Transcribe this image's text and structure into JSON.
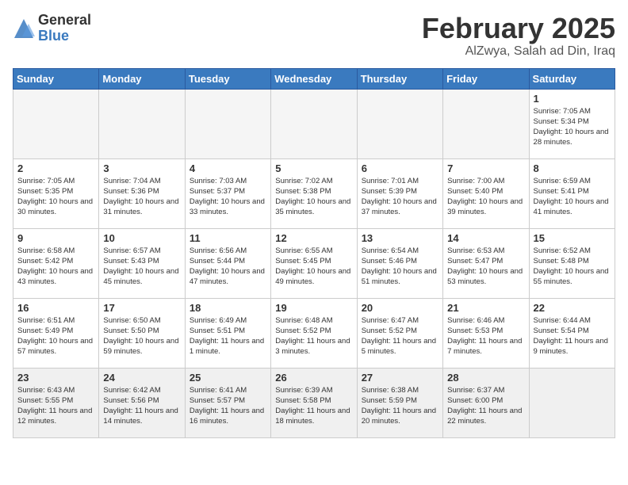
{
  "header": {
    "logo_general": "General",
    "logo_blue": "Blue",
    "title": "February 2025",
    "subtitle": "AlZwya, Salah ad Din, Iraq"
  },
  "weekdays": [
    "Sunday",
    "Monday",
    "Tuesday",
    "Wednesday",
    "Thursday",
    "Friday",
    "Saturday"
  ],
  "weeks": [
    [
      {
        "day": "",
        "info": ""
      },
      {
        "day": "",
        "info": ""
      },
      {
        "day": "",
        "info": ""
      },
      {
        "day": "",
        "info": ""
      },
      {
        "day": "",
        "info": ""
      },
      {
        "day": "",
        "info": ""
      },
      {
        "day": "1",
        "info": "Sunrise: 7:05 AM\nSunset: 5:34 PM\nDaylight: 10 hours and 28 minutes."
      }
    ],
    [
      {
        "day": "2",
        "info": "Sunrise: 7:05 AM\nSunset: 5:35 PM\nDaylight: 10 hours and 30 minutes."
      },
      {
        "day": "3",
        "info": "Sunrise: 7:04 AM\nSunset: 5:36 PM\nDaylight: 10 hours and 31 minutes."
      },
      {
        "day": "4",
        "info": "Sunrise: 7:03 AM\nSunset: 5:37 PM\nDaylight: 10 hours and 33 minutes."
      },
      {
        "day": "5",
        "info": "Sunrise: 7:02 AM\nSunset: 5:38 PM\nDaylight: 10 hours and 35 minutes."
      },
      {
        "day": "6",
        "info": "Sunrise: 7:01 AM\nSunset: 5:39 PM\nDaylight: 10 hours and 37 minutes."
      },
      {
        "day": "7",
        "info": "Sunrise: 7:00 AM\nSunset: 5:40 PM\nDaylight: 10 hours and 39 minutes."
      },
      {
        "day": "8",
        "info": "Sunrise: 6:59 AM\nSunset: 5:41 PM\nDaylight: 10 hours and 41 minutes."
      }
    ],
    [
      {
        "day": "9",
        "info": "Sunrise: 6:58 AM\nSunset: 5:42 PM\nDaylight: 10 hours and 43 minutes."
      },
      {
        "day": "10",
        "info": "Sunrise: 6:57 AM\nSunset: 5:43 PM\nDaylight: 10 hours and 45 minutes."
      },
      {
        "day": "11",
        "info": "Sunrise: 6:56 AM\nSunset: 5:44 PM\nDaylight: 10 hours and 47 minutes."
      },
      {
        "day": "12",
        "info": "Sunrise: 6:55 AM\nSunset: 5:45 PM\nDaylight: 10 hours and 49 minutes."
      },
      {
        "day": "13",
        "info": "Sunrise: 6:54 AM\nSunset: 5:46 PM\nDaylight: 10 hours and 51 minutes."
      },
      {
        "day": "14",
        "info": "Sunrise: 6:53 AM\nSunset: 5:47 PM\nDaylight: 10 hours and 53 minutes."
      },
      {
        "day": "15",
        "info": "Sunrise: 6:52 AM\nSunset: 5:48 PM\nDaylight: 10 hours and 55 minutes."
      }
    ],
    [
      {
        "day": "16",
        "info": "Sunrise: 6:51 AM\nSunset: 5:49 PM\nDaylight: 10 hours and 57 minutes."
      },
      {
        "day": "17",
        "info": "Sunrise: 6:50 AM\nSunset: 5:50 PM\nDaylight: 10 hours and 59 minutes."
      },
      {
        "day": "18",
        "info": "Sunrise: 6:49 AM\nSunset: 5:51 PM\nDaylight: 11 hours and 1 minute."
      },
      {
        "day": "19",
        "info": "Sunrise: 6:48 AM\nSunset: 5:52 PM\nDaylight: 11 hours and 3 minutes."
      },
      {
        "day": "20",
        "info": "Sunrise: 6:47 AM\nSunset: 5:52 PM\nDaylight: 11 hours and 5 minutes."
      },
      {
        "day": "21",
        "info": "Sunrise: 6:46 AM\nSunset: 5:53 PM\nDaylight: 11 hours and 7 minutes."
      },
      {
        "day": "22",
        "info": "Sunrise: 6:44 AM\nSunset: 5:54 PM\nDaylight: 11 hours and 9 minutes."
      }
    ],
    [
      {
        "day": "23",
        "info": "Sunrise: 6:43 AM\nSunset: 5:55 PM\nDaylight: 11 hours and 12 minutes."
      },
      {
        "day": "24",
        "info": "Sunrise: 6:42 AM\nSunset: 5:56 PM\nDaylight: 11 hours and 14 minutes."
      },
      {
        "day": "25",
        "info": "Sunrise: 6:41 AM\nSunset: 5:57 PM\nDaylight: 11 hours and 16 minutes."
      },
      {
        "day": "26",
        "info": "Sunrise: 6:39 AM\nSunset: 5:58 PM\nDaylight: 11 hours and 18 minutes."
      },
      {
        "day": "27",
        "info": "Sunrise: 6:38 AM\nSunset: 5:59 PM\nDaylight: 11 hours and 20 minutes."
      },
      {
        "day": "28",
        "info": "Sunrise: 6:37 AM\nSunset: 6:00 PM\nDaylight: 11 hours and 22 minutes."
      },
      {
        "day": "",
        "info": ""
      }
    ]
  ]
}
